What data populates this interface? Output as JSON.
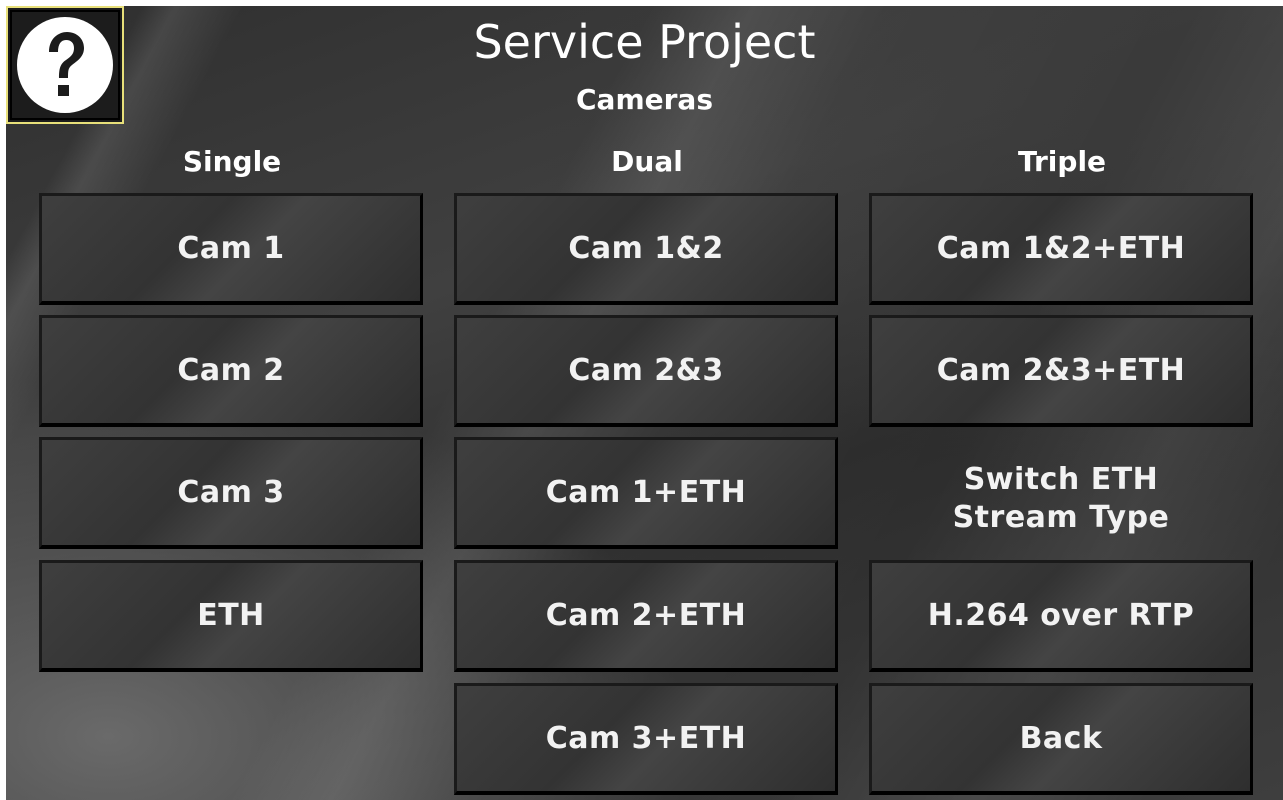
{
  "header": {
    "title": "Service Project",
    "subtitle": "Cameras",
    "help_icon": "question-mark-icon"
  },
  "columns": {
    "single": {
      "heading": "Single",
      "buttons": [
        "Cam 1",
        "Cam 2",
        "Cam 3",
        "ETH"
      ]
    },
    "dual": {
      "heading": "Dual",
      "buttons": [
        "Cam 1&2",
        "Cam 2&3",
        "Cam 1+ETH",
        "Cam 2+ETH",
        "Cam 3+ETH"
      ]
    },
    "triple": {
      "heading": "Triple",
      "buttons": [
        "Cam 1&2+ETH",
        "Cam 2&3+ETH"
      ],
      "switch_line1": "Switch ETH",
      "switch_line2": "Stream Type",
      "stream_type": "H.264 over RTP",
      "back": "Back"
    }
  },
  "colors": {
    "help_border": "#e8e07a",
    "text": "#ffffff",
    "button_face": "#3a3a3a"
  }
}
